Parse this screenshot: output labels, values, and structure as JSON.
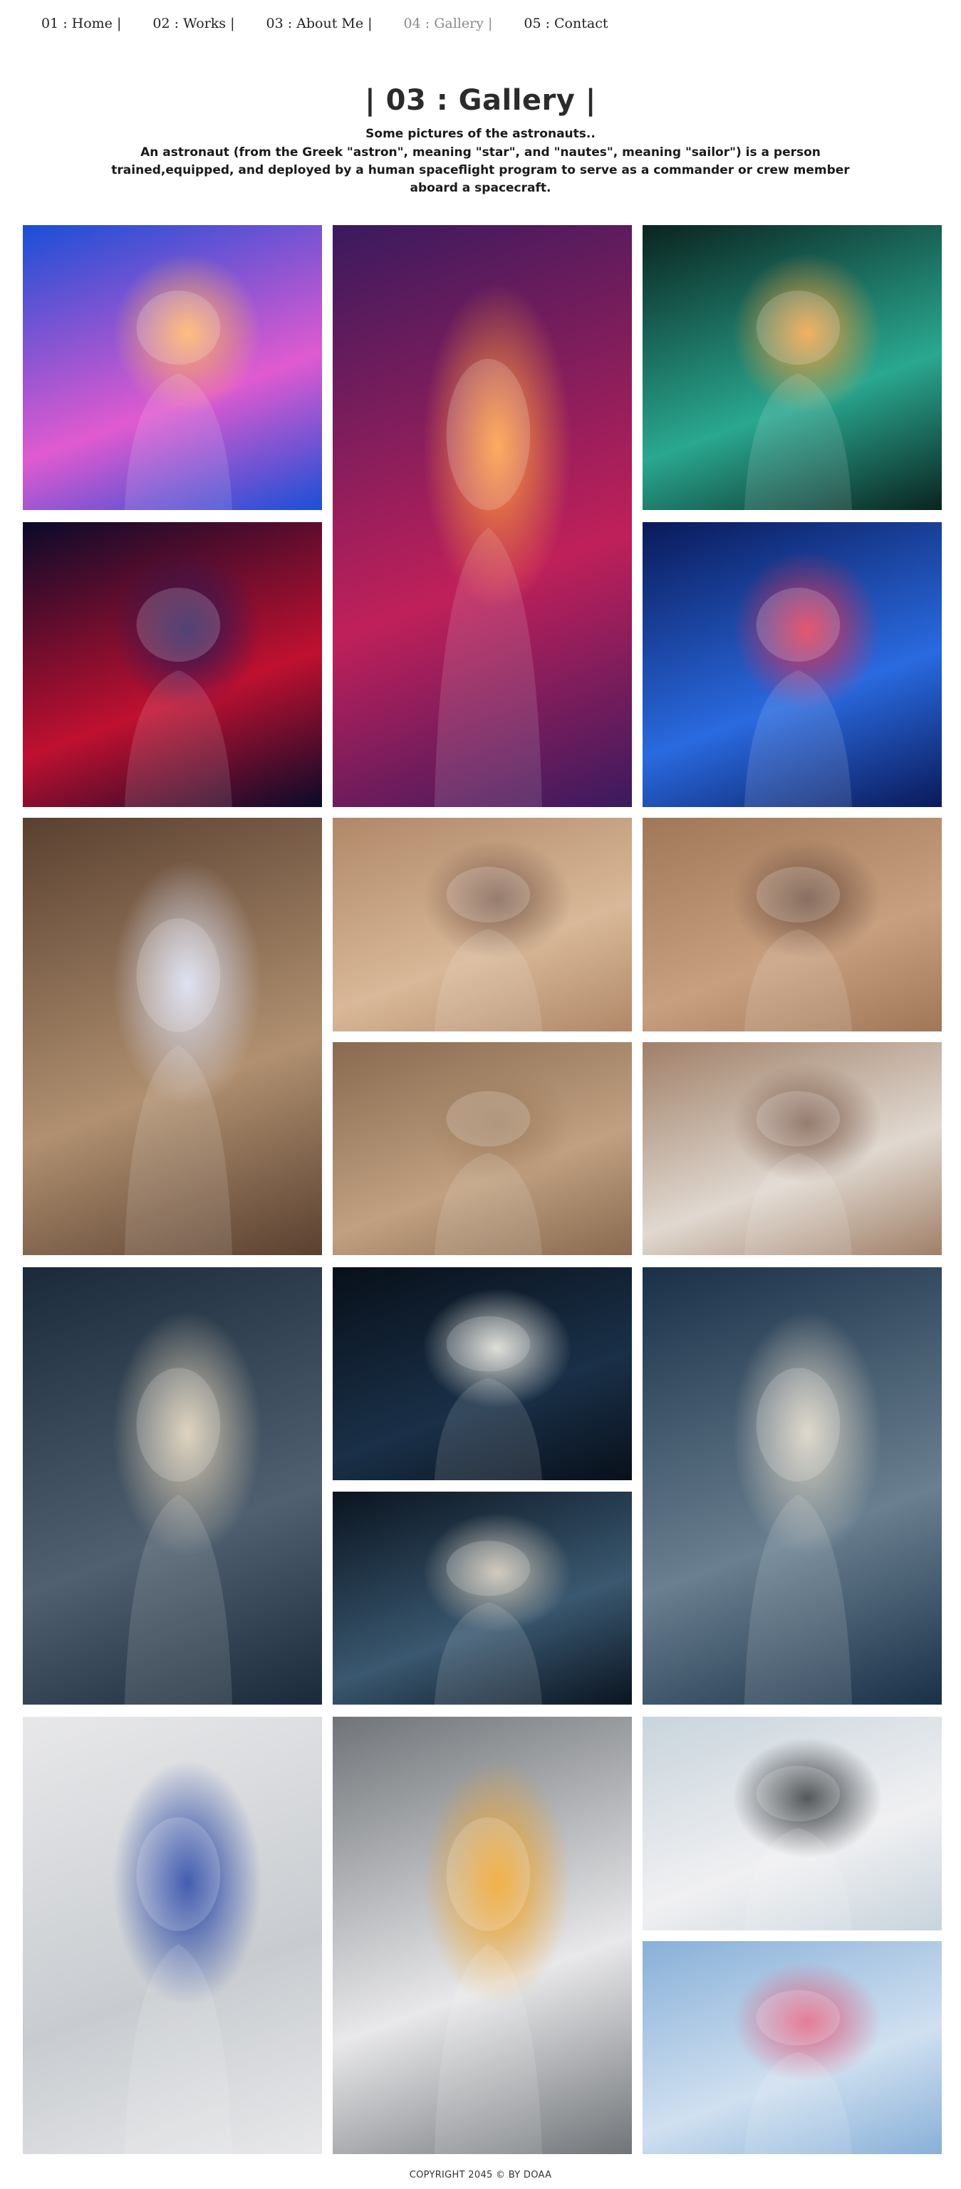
{
  "nav": {
    "items": [
      {
        "label": "01 : Home |"
      },
      {
        "label": "02 : Works |"
      },
      {
        "label": "03 : About Me |"
      },
      {
        "label": "04 : Gallery |"
      },
      {
        "label": "05 : Contact"
      }
    ],
    "active_index": 3,
    "active_color": "#8a8a8a"
  },
  "hero": {
    "title": "| 03 : Gallery |",
    "subtitle": "Some pictures of the astronauts..",
    "description": "An astronaut (from the Greek \"astron\", meaning \"star\", and \"nautes\", meaning \"sailor\") is a person trained,equipped, and deployed by a human spaceflight program to serve as a commander or crew member aboard a spacecraft."
  },
  "gallery": {
    "photos": [
      {
        "name": "photo-astronaut-blue-helmet-closeup",
        "icon": "photo-icon",
        "colors": [
          "#1a4fd6",
          "#e05ad0",
          "#ffb060"
        ]
      },
      {
        "name": "photo-astronaut-red-lit-portrait",
        "icon": "photo-icon",
        "colors": [
          "#3a1a5e",
          "#c0205a",
          "#ff9a3c"
        ]
      },
      {
        "name": "photo-astronaut-green-helmet",
        "icon": "photo-icon",
        "colors": [
          "#0a2420",
          "#2aa890",
          "#f0a040"
        ]
      },
      {
        "name": "photo-astronaut-red-neon-seated",
        "icon": "photo-icon",
        "colors": [
          "#0a0a2a",
          "#c01030",
          "#2a1a5a"
        ]
      },
      {
        "name": "photo-astronaut-holding-helmet-blue",
        "icon": "photo-icon",
        "colors": [
          "#0a1a5a",
          "#2a6ae0",
          "#e03050"
        ]
      },
      {
        "name": "photo-astronaut-lying-on-pebbles",
        "icon": "photo-icon",
        "colors": [
          "#5a4030",
          "#b09070",
          "#d8dcf0"
        ]
      },
      {
        "name": "photo-astronaut-desert-hills",
        "icon": "photo-icon",
        "colors": [
          "#b08868",
          "#d8b898",
          "#806050"
        ]
      },
      {
        "name": "photo-astronaut-canyon-walk",
        "icon": "photo-icon",
        "colors": [
          "#a07858",
          "#c8a080",
          "#705040"
        ]
      },
      {
        "name": "photo-astronaut-desert-distance",
        "icon": "photo-icon",
        "colors": [
          "#8a6a50",
          "#c0a080",
          "#a08060"
        ]
      },
      {
        "name": "photo-astronauts-desert-pair",
        "icon": "photo-icon",
        "colors": [
          "#a08068",
          "#e0d8d0",
          "#806050"
        ]
      },
      {
        "name": "photo-astronaut-dark-suit-dunes",
        "icon": "photo-icon",
        "colors": [
          "#1a2a3a",
          "#506070",
          "#d8cab0"
        ]
      },
      {
        "name": "photo-astronaut-dark-backdrop",
        "icon": "photo-icon",
        "colors": [
          "#08101a",
          "#1a3048",
          "#d8d8d0"
        ]
      },
      {
        "name": "photo-astronaut-smoke-standing",
        "icon": "photo-icon",
        "colors": [
          "#1a3048",
          "#6a8090",
          "#d8d0c0"
        ]
      },
      {
        "name": "photo-astronaut-holding-helmet-smoke",
        "icon": "photo-icon",
        "colors": [
          "#0a1420",
          "#3a5870",
          "#c8c0b0"
        ]
      },
      {
        "name": "photo-astronaut-white-suit-window",
        "icon": "photo-icon",
        "colors": [
          "#e8e8ea",
          "#c8ccd0",
          "#1a3aa0"
        ]
      },
      {
        "name": "photo-astronaut-seated-station",
        "icon": "photo-icon",
        "colors": [
          "#707478",
          "#e8e8ea",
          "#f0a020"
        ]
      },
      {
        "name": "photo-astronaut-platform-helmet",
        "icon": "photo-icon",
        "colors": [
          "#c8d4dc",
          "#f0f0f2",
          "#303438"
        ]
      },
      {
        "name": "photo-astronaut-pink-helmet-sky",
        "icon": "photo-icon",
        "colors": [
          "#88b0d8",
          "#d0e0f0",
          "#e06080"
        ]
      }
    ]
  },
  "footer": {
    "text": "COPYRIGHT 2045 © BY DOAA"
  }
}
